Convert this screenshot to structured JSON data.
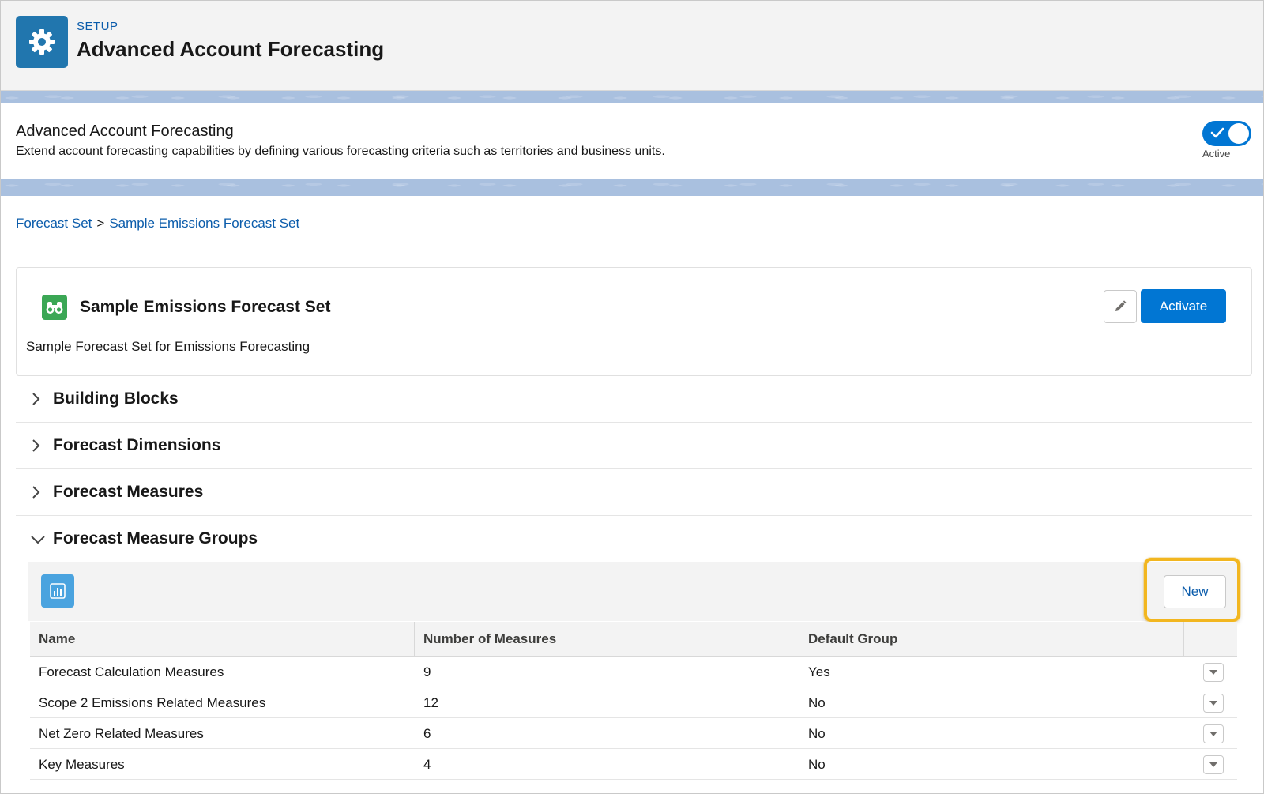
{
  "header": {
    "setup_label": "SETUP",
    "title": "Advanced Account Forecasting"
  },
  "feature": {
    "title": "Advanced Account Forecasting",
    "description": "Extend account forecasting capabilities by defining various forecasting criteria such as territories and business units.",
    "toggle_label": "Active",
    "toggle_on": true
  },
  "breadcrumb": {
    "items": [
      "Forecast Set",
      "Sample Emissions Forecast Set"
    ],
    "separator": ">"
  },
  "card": {
    "title": "Sample Emissions Forecast Set",
    "description": "Sample Forecast Set for Emissions Forecasting",
    "activate_label": "Activate"
  },
  "sections": [
    {
      "label": "Building Blocks",
      "expanded": false
    },
    {
      "label": "Forecast Dimensions",
      "expanded": false
    },
    {
      "label": "Forecast Measures",
      "expanded": false
    },
    {
      "label": "Forecast Measure Groups",
      "expanded": true
    }
  ],
  "related_list": {
    "new_label": "New",
    "columns": [
      "Name",
      "Number of Measures",
      "Default Group"
    ],
    "rows": [
      {
        "name": "Forecast Calculation Measures",
        "count": "9",
        "default": "Yes"
      },
      {
        "name": "Scope 2 Emissions Related Measures",
        "count": "12",
        "default": "No"
      },
      {
        "name": "Net Zero Related Measures",
        "count": "6",
        "default": "No"
      },
      {
        "name": "Key Measures",
        "count": "4",
        "default": "No"
      }
    ]
  },
  "colors": {
    "brand": "#0176d3",
    "setup_icon": "#2176ae",
    "card_icon": "#3ba755",
    "list_icon": "#4aa3df",
    "highlight": "#f2b61f"
  },
  "icons": [
    "gear-icon",
    "checkmark-icon",
    "binoculars-icon",
    "pencil-icon",
    "chevron-right-icon",
    "chevron-down-icon",
    "bar-chart-icon",
    "dropdown-arrow-icon"
  ]
}
